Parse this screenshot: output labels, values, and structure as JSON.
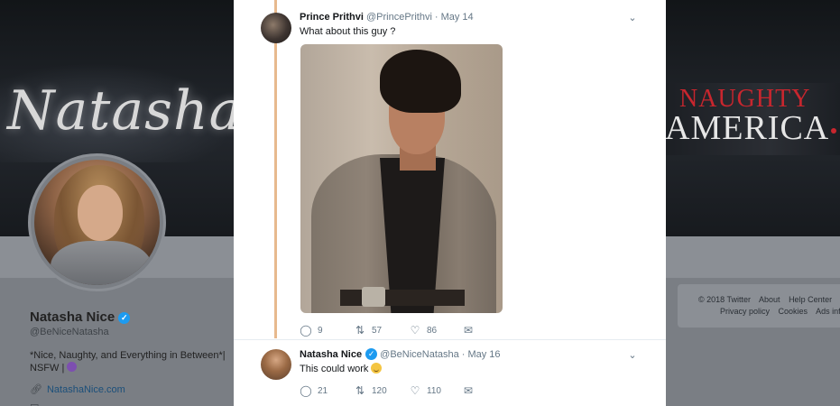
{
  "background_profile": {
    "banner_name": "Natasha Ni",
    "banner_brand_top": "NAUGHTY",
    "banner_brand_bottom": "AMERICA",
    "name": "Natasha Nice",
    "handle": "@BeNiceNatasha",
    "bio": "*Nice, Naughty, and Everything in Between*| NSFW |",
    "link": "NatashaNice.com",
    "footer": {
      "row1": [
        "© 2018 Twitter",
        "About",
        "Help Center"
      ],
      "row2": [
        "Privacy policy",
        "Cookies",
        "Ads info"
      ]
    }
  },
  "tweets": [
    {
      "name": "Prince Prithvi",
      "handle": "@PrincePrithvi",
      "separator": "·",
      "date": "May 14",
      "text": "What about this guy ?",
      "has_photo": true,
      "replies": "9",
      "retweets": "57",
      "likes": "86"
    },
    {
      "name": "Natasha Nice",
      "verified": true,
      "handle": "@BeNiceNatasha",
      "separator": "·",
      "date": "May 16",
      "text": "This could work",
      "replies": "21",
      "retweets": "120",
      "likes": "110"
    }
  ],
  "icons": {
    "reply": "reply-icon",
    "retweet": "retweet-icon",
    "like": "heart-icon",
    "message": "envelope-icon",
    "more": "chevron-down-icon",
    "verified": "verified-badge-icon"
  },
  "colors": {
    "thread_line": "#e7b98e",
    "verified": "#1d9bf0",
    "brand_red": "#c8262e",
    "link": "#1b4f7a"
  }
}
